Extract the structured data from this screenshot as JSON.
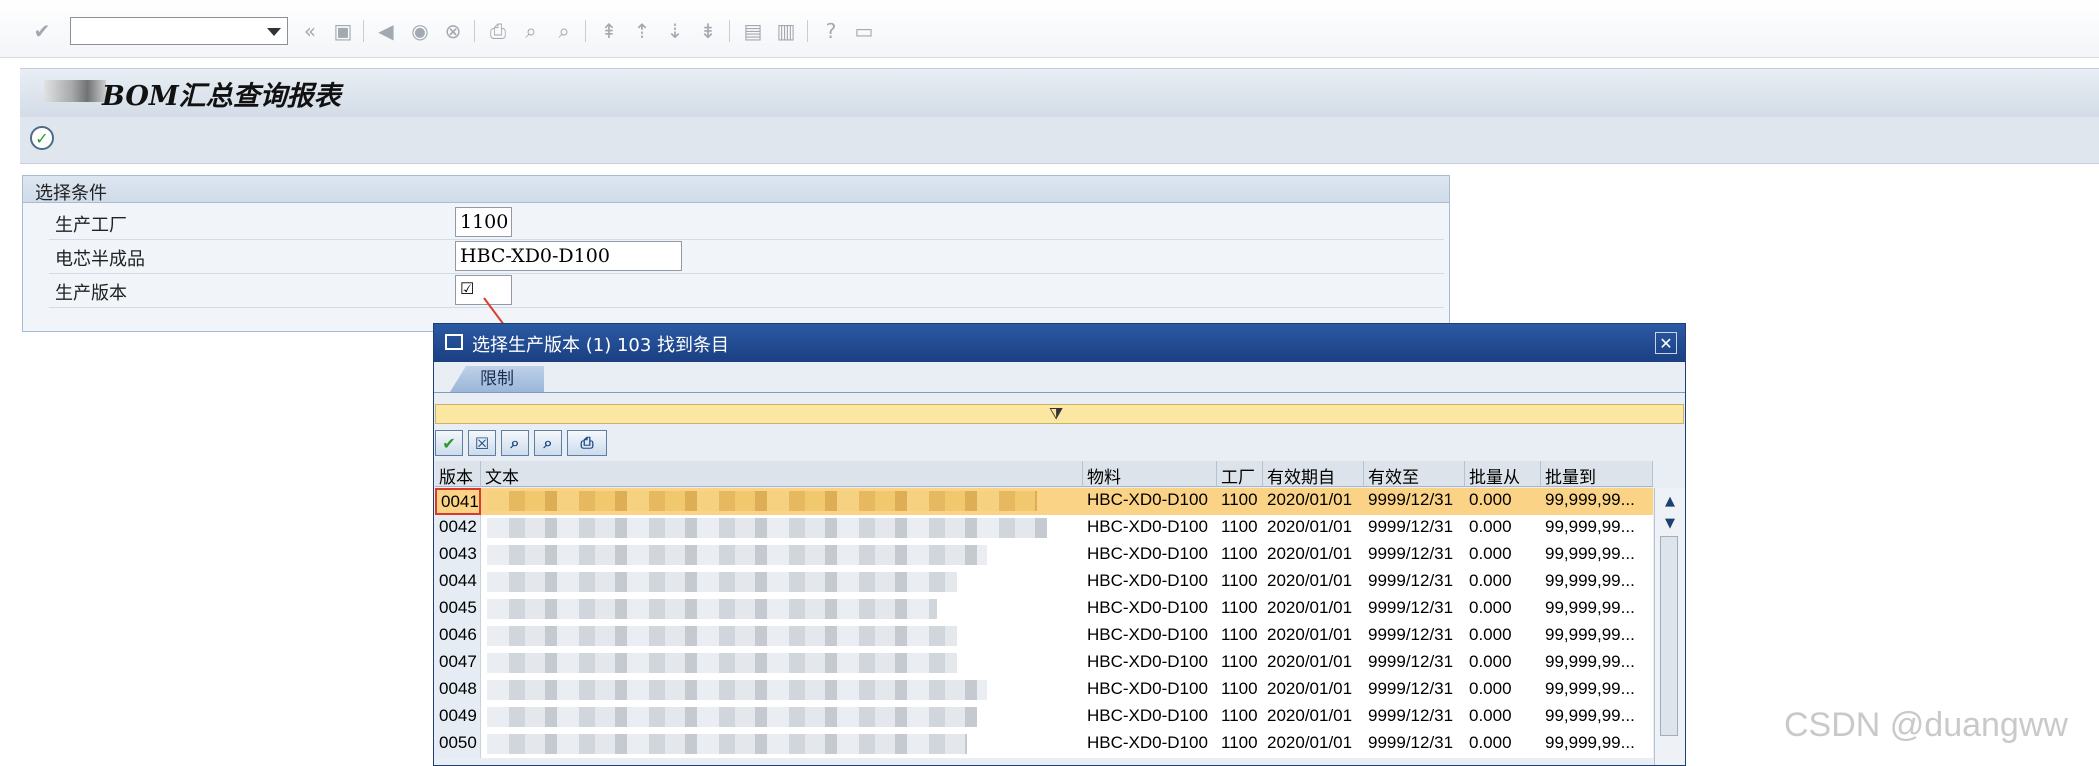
{
  "toolbar": {
    "command_field": "",
    "icons": [
      "enter-icon",
      "back-icon",
      "save-icon",
      "prev-icon",
      "exit-icon",
      "cancel-icon",
      "print-icon",
      "find-icon",
      "find-next-icon",
      "first-page-icon",
      "prev-page-icon",
      "next-page-icon",
      "last-page-icon",
      "new-session-icon",
      "shortcut-icon",
      "help-icon",
      "layout-icon"
    ]
  },
  "page": {
    "title": "BOM汇总查询报表"
  },
  "selection": {
    "header": "选择条件",
    "fields": [
      {
        "label": "生产工厂",
        "value": "1100"
      },
      {
        "label": "电芯半成品",
        "value": "HBC-XD0-D100"
      },
      {
        "label": "生产版本",
        "value": "☑"
      }
    ]
  },
  "popup": {
    "title": "选择生产版本 (1)  103 找到条目",
    "tab": "限制",
    "columns": [
      "版本",
      "文本",
      "物料",
      "工厂",
      "有效期自",
      "有效至",
      "批量从",
      "批量到"
    ],
    "rows": [
      {
        "version": "0041",
        "material": "HBC-XD0-D100",
        "plant": "1100",
        "valid_from": "2020/01/01",
        "valid_to": "9999/12/31",
        "lot_from": "0.000",
        "lot_to": "99,999,99..."
      },
      {
        "version": "0042",
        "material": "HBC-XD0-D100",
        "plant": "1100",
        "valid_from": "2020/01/01",
        "valid_to": "9999/12/31",
        "lot_from": "0.000",
        "lot_to": "99,999,99..."
      },
      {
        "version": "0043",
        "material": "HBC-XD0-D100",
        "plant": "1100",
        "valid_from": "2020/01/01",
        "valid_to": "9999/12/31",
        "lot_from": "0.000",
        "lot_to": "99,999,99..."
      },
      {
        "version": "0044",
        "material": "HBC-XD0-D100",
        "plant": "1100",
        "valid_from": "2020/01/01",
        "valid_to": "9999/12/31",
        "lot_from": "0.000",
        "lot_to": "99,999,99..."
      },
      {
        "version": "0045",
        "material": "HBC-XD0-D100",
        "plant": "1100",
        "valid_from": "2020/01/01",
        "valid_to": "9999/12/31",
        "lot_from": "0.000",
        "lot_to": "99,999,99..."
      },
      {
        "version": "0046",
        "material": "HBC-XD0-D100",
        "plant": "1100",
        "valid_from": "2020/01/01",
        "valid_to": "9999/12/31",
        "lot_from": "0.000",
        "lot_to": "99,999,99..."
      },
      {
        "version": "0047",
        "material": "HBC-XD0-D100",
        "plant": "1100",
        "valid_from": "2020/01/01",
        "valid_to": "9999/12/31",
        "lot_from": "0.000",
        "lot_to": "99,999,99..."
      },
      {
        "version": "0048",
        "material": "HBC-XD0-D100",
        "plant": "1100",
        "valid_from": "2020/01/01",
        "valid_to": "9999/12/31",
        "lot_from": "0.000",
        "lot_to": "99,999,99..."
      },
      {
        "version": "0049",
        "material": "HBC-XD0-D100",
        "plant": "1100",
        "valid_from": "2020/01/01",
        "valid_to": "9999/12/31",
        "lot_from": "0.000",
        "lot_to": "99,999,99..."
      },
      {
        "version": "0050",
        "material": "HBC-XD0-D100",
        "plant": "1100",
        "valid_from": "2020/01/01",
        "valid_to": "9999/12/31",
        "lot_from": "0.000",
        "lot_to": "99,999,99..."
      }
    ],
    "selected_row": 0
  },
  "watermark": "CSDN @duangww",
  "colors": {
    "popup_title": "#1b3f82",
    "selected_row": "#fbd386",
    "filter_bar": "#fbe6a2",
    "highlight_border": "#d83a2e"
  }
}
